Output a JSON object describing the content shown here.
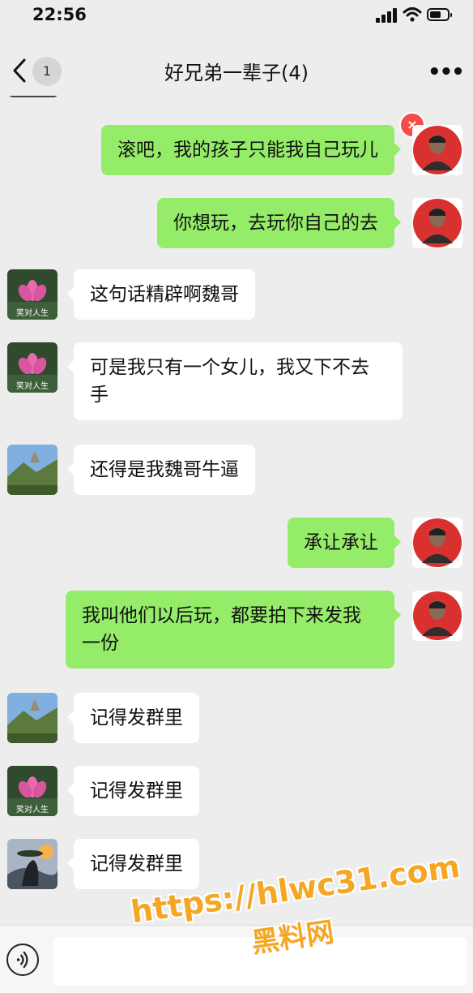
{
  "status": {
    "time": "22:56"
  },
  "nav": {
    "unread": "1",
    "title": "好兄弟一辈子(4)",
    "more": "•••"
  },
  "messages": [
    {
      "dir": "out",
      "sender": "me",
      "text": "滚吧，我的孩子只能我自己玩儿",
      "failed": true
    },
    {
      "dir": "out",
      "sender": "me",
      "text": "你想玩，去玩你自己的去"
    },
    {
      "dir": "in",
      "sender": "lotus",
      "avatar_text": "笑对人生",
      "text": "这句话精辟啊魏哥"
    },
    {
      "dir": "in",
      "sender": "lotus",
      "avatar_text": "笑对人生",
      "text": "可是我只有一个女儿，我又下不去手"
    },
    {
      "dir": "in",
      "sender": "landscape",
      "text": "还得是我魏哥牛逼"
    },
    {
      "dir": "out",
      "sender": "me",
      "text": "承让承让"
    },
    {
      "dir": "out",
      "sender": "me",
      "text": "我叫他们以后玩，都要拍下来发我一份"
    },
    {
      "dir": "in",
      "sender": "landscape",
      "text": "记得发群里"
    },
    {
      "dir": "in",
      "sender": "lotus",
      "avatar_text": "笑对人生",
      "text": "记得发群里"
    },
    {
      "dir": "in",
      "sender": "sunset",
      "text": "记得发群里"
    }
  ],
  "failed_icon": "×",
  "composer": {
    "value": ""
  },
  "watermark": {
    "line1": "https://hlwc31.com",
    "line2": "黑料网"
  },
  "colors": {
    "background": "#ededed",
    "outgoing_bubble": "#95ec69",
    "incoming_bubble": "#ffffff",
    "error": "#f54b4b",
    "watermark": "#f5a623"
  }
}
